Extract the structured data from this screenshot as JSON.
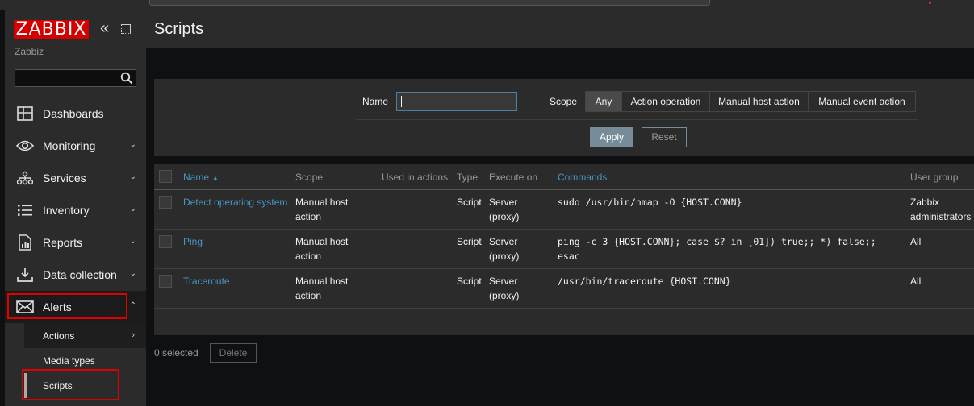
{
  "sidebar": {
    "logo": "ZABBIX",
    "server_name": "Zabbiz",
    "search": {
      "value": "",
      "placeholder": ""
    },
    "items": [
      {
        "label": "Dashboards"
      },
      {
        "label": "Monitoring"
      },
      {
        "label": "Services"
      },
      {
        "label": "Inventory"
      },
      {
        "label": "Reports"
      },
      {
        "label": "Data collection"
      },
      {
        "label": "Alerts"
      }
    ],
    "alerts_submenu": [
      {
        "label": "Actions"
      },
      {
        "label": "Media types"
      },
      {
        "label": "Scripts"
      }
    ]
  },
  "header": {
    "title": "Scripts"
  },
  "filter": {
    "name_label": "Name",
    "name_value": "",
    "scope_label": "Scope",
    "scope_options": [
      "Any",
      "Action operation",
      "Manual host action",
      "Manual event action"
    ],
    "scope_selected": "Any",
    "apply_label": "Apply",
    "reset_label": "Reset"
  },
  "table": {
    "columns": [
      "Name",
      "Scope",
      "Used in actions",
      "Type",
      "Execute on",
      "Commands",
      "User group"
    ],
    "sort_indicator": "▲",
    "rows": [
      {
        "name": "Detect operating system",
        "scope": [
          "Manual host",
          "action"
        ],
        "used_in_actions": "",
        "type": "Script",
        "execute_on": [
          "Server",
          "(proxy)"
        ],
        "commands": [
          "sudo /usr/bin/nmap -O {HOST.CONN}"
        ],
        "user_group": [
          "Zabbix",
          "administrators"
        ]
      },
      {
        "name": "Ping",
        "scope": [
          "Manual host",
          "action"
        ],
        "used_in_actions": "",
        "type": "Script",
        "execute_on": [
          "Server",
          "(proxy)"
        ],
        "commands": [
          "ping -c 3 {HOST.CONN}; case $? in [01]) true;; *) false;;",
          "esac"
        ],
        "user_group": [
          "All"
        ]
      },
      {
        "name": "Traceroute",
        "scope": [
          "Manual host",
          "action"
        ],
        "used_in_actions": "",
        "type": "Script",
        "execute_on": [
          "Server",
          "(proxy)"
        ],
        "commands": [
          "/usr/bin/traceroute {HOST.CONN}"
        ],
        "user_group": [
          "All"
        ]
      }
    ]
  },
  "footer": {
    "selected_text": "0 selected",
    "delete_label": "Delete"
  },
  "colors": {
    "brand": "#d40000",
    "link": "#4796c4",
    "highlight": "#e00000",
    "apply": "#768d99"
  }
}
